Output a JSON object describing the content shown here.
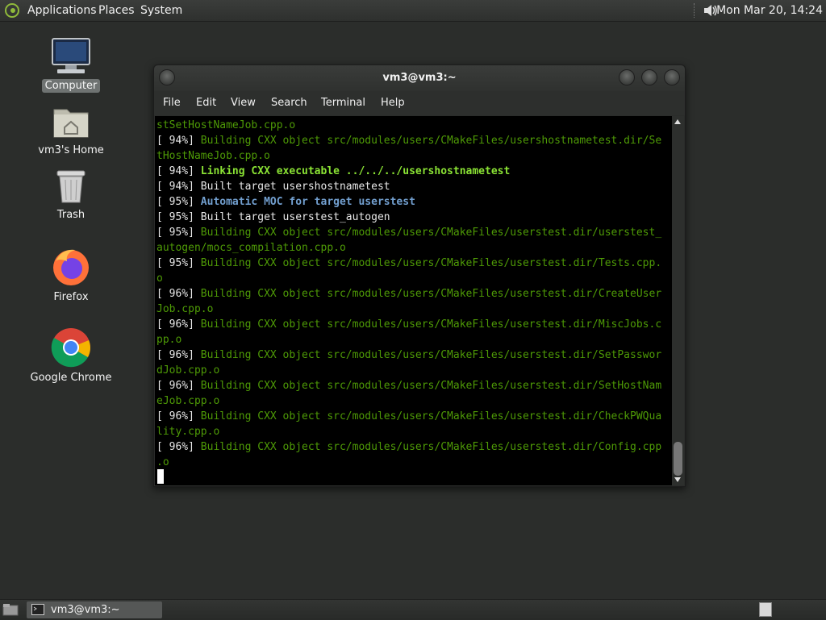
{
  "top_panel": {
    "menus": [
      "Applications",
      "Places",
      "System"
    ],
    "clock": "Mon Mar 20, 14:24"
  },
  "desktop": {
    "icons": [
      {
        "label": "Computer",
        "icon": "computer-icon"
      },
      {
        "label": "vm3's Home",
        "icon": "home-folder-icon"
      },
      {
        "label": "Trash",
        "icon": "trash-icon"
      },
      {
        "label": "Firefox",
        "icon": "firefox-icon"
      },
      {
        "label": "Google Chrome",
        "icon": "chrome-icon"
      }
    ]
  },
  "terminal": {
    "title": "vm3@vm3:~",
    "menu": [
      "File",
      "Edit",
      "View",
      "Search",
      "Terminal",
      "Help"
    ],
    "lines": [
      {
        "prefix": "",
        "text": "stSetHostNameJob.cpp.o",
        "style": "g"
      },
      {
        "prefix": "[ 94%] ",
        "text": "Building CXX object src/modules/users/CMakeFiles/usershostnametest.dir/Se",
        "style": "g"
      },
      {
        "prefix": "",
        "text": "tHostNameJob.cpp.o",
        "style": "g"
      },
      {
        "prefix": "[ 94%] ",
        "text": "Linking CXX executable ../../../usershostnametest",
        "style": "bg"
      },
      {
        "prefix": "[ 94%] ",
        "text": "Built target usershostnametest",
        "style": "n"
      },
      {
        "prefix": "[ 95%] ",
        "text": "Automatic MOC for target userstest",
        "style": "bb"
      },
      {
        "prefix": "[ 95%] ",
        "text": "Built target userstest_autogen",
        "style": "n"
      },
      {
        "prefix": "[ 95%] ",
        "text": "Building CXX object src/modules/users/CMakeFiles/userstest.dir/userstest_",
        "style": "g"
      },
      {
        "prefix": "",
        "text": "autogen/mocs_compilation.cpp.o",
        "style": "g"
      },
      {
        "prefix": "[ 95%] ",
        "text": "Building CXX object src/modules/users/CMakeFiles/userstest.dir/Tests.cpp.",
        "style": "g"
      },
      {
        "prefix": "",
        "text": "o",
        "style": "g"
      },
      {
        "prefix": "[ 96%] ",
        "text": "Building CXX object src/modules/users/CMakeFiles/userstest.dir/CreateUser",
        "style": "g"
      },
      {
        "prefix": "",
        "text": "Job.cpp.o",
        "style": "g"
      },
      {
        "prefix": "[ 96%] ",
        "text": "Building CXX object src/modules/users/CMakeFiles/userstest.dir/MiscJobs.c",
        "style": "g"
      },
      {
        "prefix": "",
        "text": "pp.o",
        "style": "g"
      },
      {
        "prefix": "[ 96%] ",
        "text": "Building CXX object src/modules/users/CMakeFiles/userstest.dir/SetPasswor",
        "style": "g"
      },
      {
        "prefix": "",
        "text": "dJob.cpp.o",
        "style": "g"
      },
      {
        "prefix": "[ 96%] ",
        "text": "Building CXX object src/modules/users/CMakeFiles/userstest.dir/SetHostNam",
        "style": "g"
      },
      {
        "prefix": "",
        "text": "eJob.cpp.o",
        "style": "g"
      },
      {
        "prefix": "[ 96%] ",
        "text": "Building CXX object src/modules/users/CMakeFiles/userstest.dir/CheckPWQua",
        "style": "g"
      },
      {
        "prefix": "",
        "text": "lity.cpp.o",
        "style": "g"
      },
      {
        "prefix": "[ 96%] ",
        "text": "Building CXX object src/modules/users/CMakeFiles/userstest.dir/Config.cpp",
        "style": "g"
      },
      {
        "prefix": "",
        "text": ".o",
        "style": "g"
      }
    ]
  },
  "taskbar": {
    "window_button": "vm3@vm3:~"
  },
  "colors": {
    "desktop_bg": "#2b2d2b",
    "term_green": "#4e9a06",
    "term_bright_green": "#8ae234",
    "term_bright_blue": "#729fcf"
  }
}
